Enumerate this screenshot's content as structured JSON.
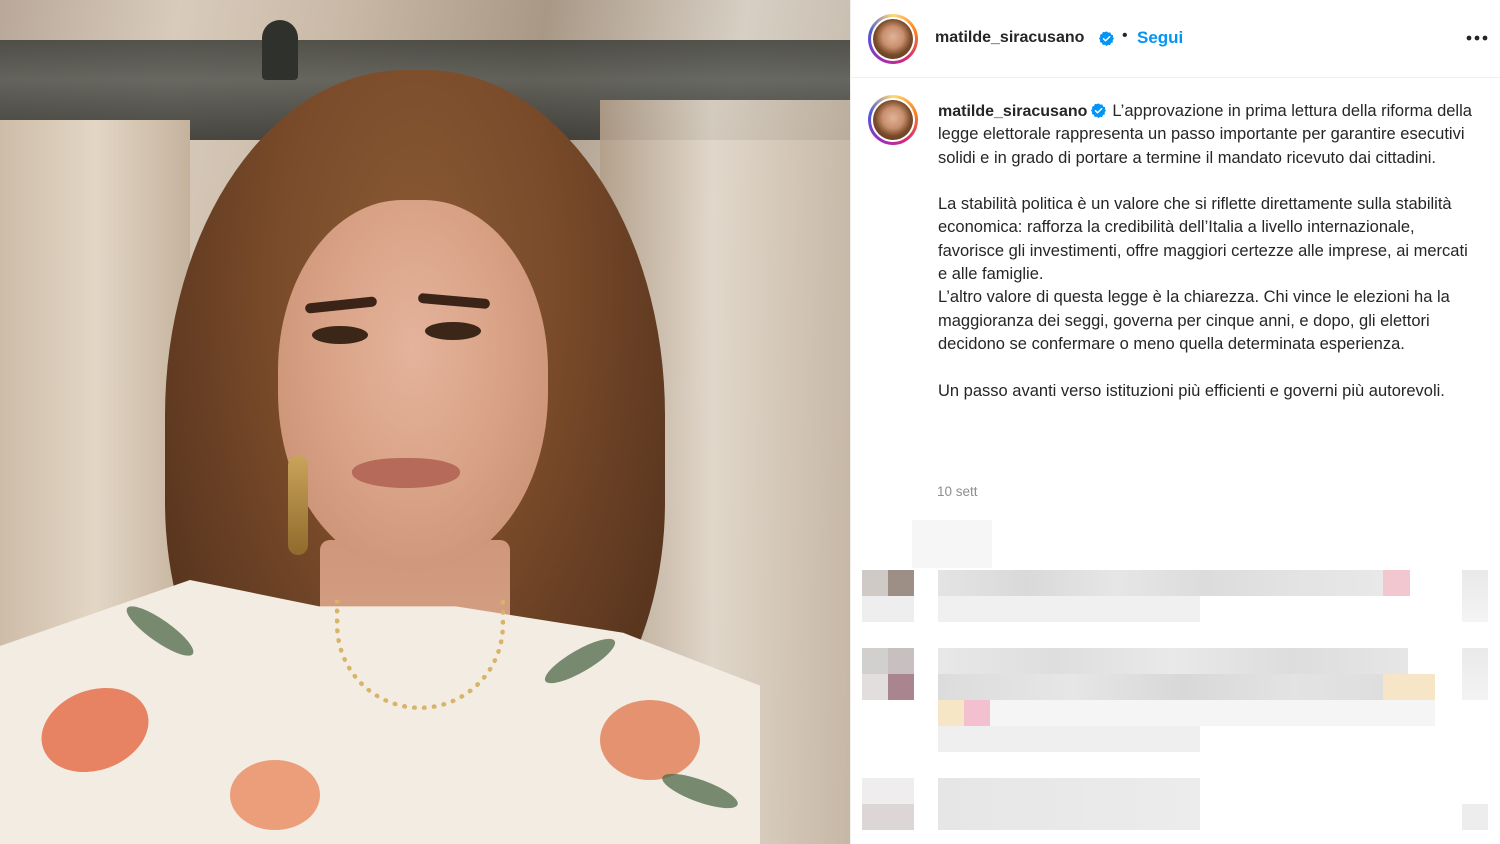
{
  "post": {
    "username": "matilde_siracusano",
    "separator": "•",
    "follow_label": "Segui",
    "caption": {
      "p1": "L’approvazione in prima lettura della riforma della legge elettorale rappresenta un passo importante per garantire esecutivi solidi e in grado di portare a termine il mandato ricevuto dai cittadini.",
      "p2": "La stabilità politica è un valore che si riflette direttamente sulla stabilità economica: rafforza la credibilità dell’Italia a livello internazionale, favorisce gli investimenti, offre maggiori certezze alle imprese, ai mercati e alle famiglie.",
      "p3": "L’altro valore di questa legge è la chiarezza. Chi vince le elezioni ha la maggioranza dei seggi, governa per cinque anni, e dopo, gli elettori decidono se confermare o meno quella determinata esperienza.",
      "p4": "Un passo avanti verso istituzioni più efficienti e governi più autorevoli."
    },
    "timestamp": "10 sett"
  },
  "icons": {
    "verified": "verified-badge-icon",
    "more": "more-options-icon"
  },
  "colors": {
    "link_blue": "#0095f6",
    "verified_blue": "#0095f6",
    "text": "#262626",
    "muted": "#8e8e8e"
  }
}
